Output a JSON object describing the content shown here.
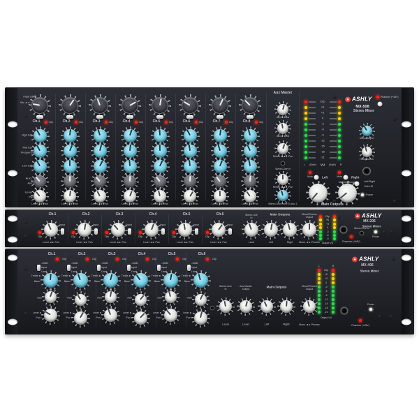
{
  "colors": {
    "panel": "#22252b",
    "accent_cyan": "#6fc8de",
    "led_red": "#ff2014",
    "led_yellow": "#ffd400",
    "led_green": "#2ee04a",
    "logo_red": "#d7261d"
  },
  "mx508": {
    "brand": "ASHLY",
    "model": "MX-508",
    "product": "Stereo Mixer",
    "left": {
      "input": "Input (dB)",
      "mic_line": "Mic ◄ ► Line",
      "high": "High EQ ―",
      "mid": "Mid EQ ―",
      "freq": "Frequency ◦",
      "low": "Low EQ ―",
      "aux1": "Aux1 ―",
      "aux2": "Aux2 ◦",
      "level": "Level ―",
      "pan": "Pan ◦"
    },
    "channels": [
      "Ch.1",
      "Ch.2",
      "Ch.3",
      "Ch.4",
      "Ch.5",
      "Ch.6",
      "Ch.7",
      "Ch.8"
    ],
    "clip": "Clip",
    "level_pan": "Level ◄► Pan",
    "aux_master": {
      "title": "Aux Master",
      "aux1": "Aux 1 Send",
      "aux2": "Aux 2 Send",
      "ret1": "Return 1 ◄► Pan",
      "line_in": "Stereo Line In",
      "ret2": "Return 2 ◄► Pan",
      "to_aux": "Stereo Line Level To Aux 1"
    },
    "meter": {
      "scale": [
        "Clip",
        "+6",
        "+3",
        "0",
        "-3",
        "-6",
        "-9",
        "-12",
        "-15",
        "-18",
        "-21"
      ],
      "colors": [
        "r",
        "y",
        "y",
        "y",
        "g",
        "g",
        "g",
        "g",
        "g",
        "g",
        "g"
      ],
      "vu": "VU",
      "both": "(Both)",
      "left": "L",
      "right": "R"
    },
    "outputs": {
      "title": "Main Outputs",
      "mute": "Mute",
      "left": "Left",
      "right": "Right"
    },
    "right": {
      "phantom": "Phantom (+48V)",
      "mono": "Mono Output",
      "phones": "Headphones",
      "select": "Meters/Phones Select",
      "lr": "Left+Right",
      "sub": "Sub L/R",
      "power": "Power"
    }
  },
  "mx206": {
    "brand": "ASHLY",
    "model": "MX-206",
    "product": "Stereo Mixer",
    "channels": [
      "Ch.1",
      "Ch.2",
      "Ch.3",
      "Ch.4",
      "Ch.5",
      "Ch.6"
    ],
    "clip": "Clip",
    "input_sw": "Input",
    "level_pan": "Level ◄► Pan",
    "line_in": {
      "title": "Stereo Line In",
      "sub": "Level"
    },
    "outputs": {
      "title": "Main Outputs",
      "left": "Left",
      "right": "Right"
    },
    "mono": {
      "title": "Mono/Phones Output",
      "sub": "Mono ◄► Phones"
    },
    "meter": {
      "scale": [
        "Clip",
        "+6",
        "+3",
        "0",
        "-3",
        "-6",
        "-9"
      ],
      "colors": [
        "r",
        "y",
        "y",
        "y",
        "g",
        "g",
        "g"
      ],
      "vu": "Output VU"
    },
    "jack_label": "Stereo Line In",
    "phantom": "Phantom (+48V)",
    "power": "Power"
  },
  "mx406": {
    "brand": "ASHLY",
    "model": "MX-406",
    "product": "Stereo Mixer",
    "channels": [
      "Ch.1",
      "Ch.2",
      "Ch.3",
      "Ch.4",
      "Ch.5",
      "Ch.6"
    ],
    "clip": "Clip",
    "switch_labels": [
      "-10dB",
      "Input",
      "Line"
    ],
    "treble": "Treble ►",
    "bass": "Bass ◦",
    "aux": "Aux",
    "level": "Level ►",
    "pan": "Pan ◦",
    "line_in": {
      "title": "Stereo Line In",
      "sub": "Level"
    },
    "aux_out": {
      "title": "Aux Master Output",
      "sub": "Level"
    },
    "outputs": {
      "title": "Main Outputs",
      "left": "Left",
      "right": "Right"
    },
    "mono": {
      "title": "Mono/Phones Output",
      "sub": "Mono ◄► Phones"
    },
    "meter": {
      "scale": [
        "Clip",
        "+6",
        "+3",
        "0",
        "-3",
        "-6",
        "-9",
        "-12",
        "-15",
        "-18",
        "-21"
      ],
      "colors": [
        "r",
        "y",
        "y",
        "y",
        "g",
        "g",
        "g",
        "g",
        "g",
        "g",
        "g"
      ],
      "vu": "Output VU",
      "left": "L",
      "right": "R"
    },
    "phantom": "Phantom (+48V)",
    "power": "Power"
  }
}
